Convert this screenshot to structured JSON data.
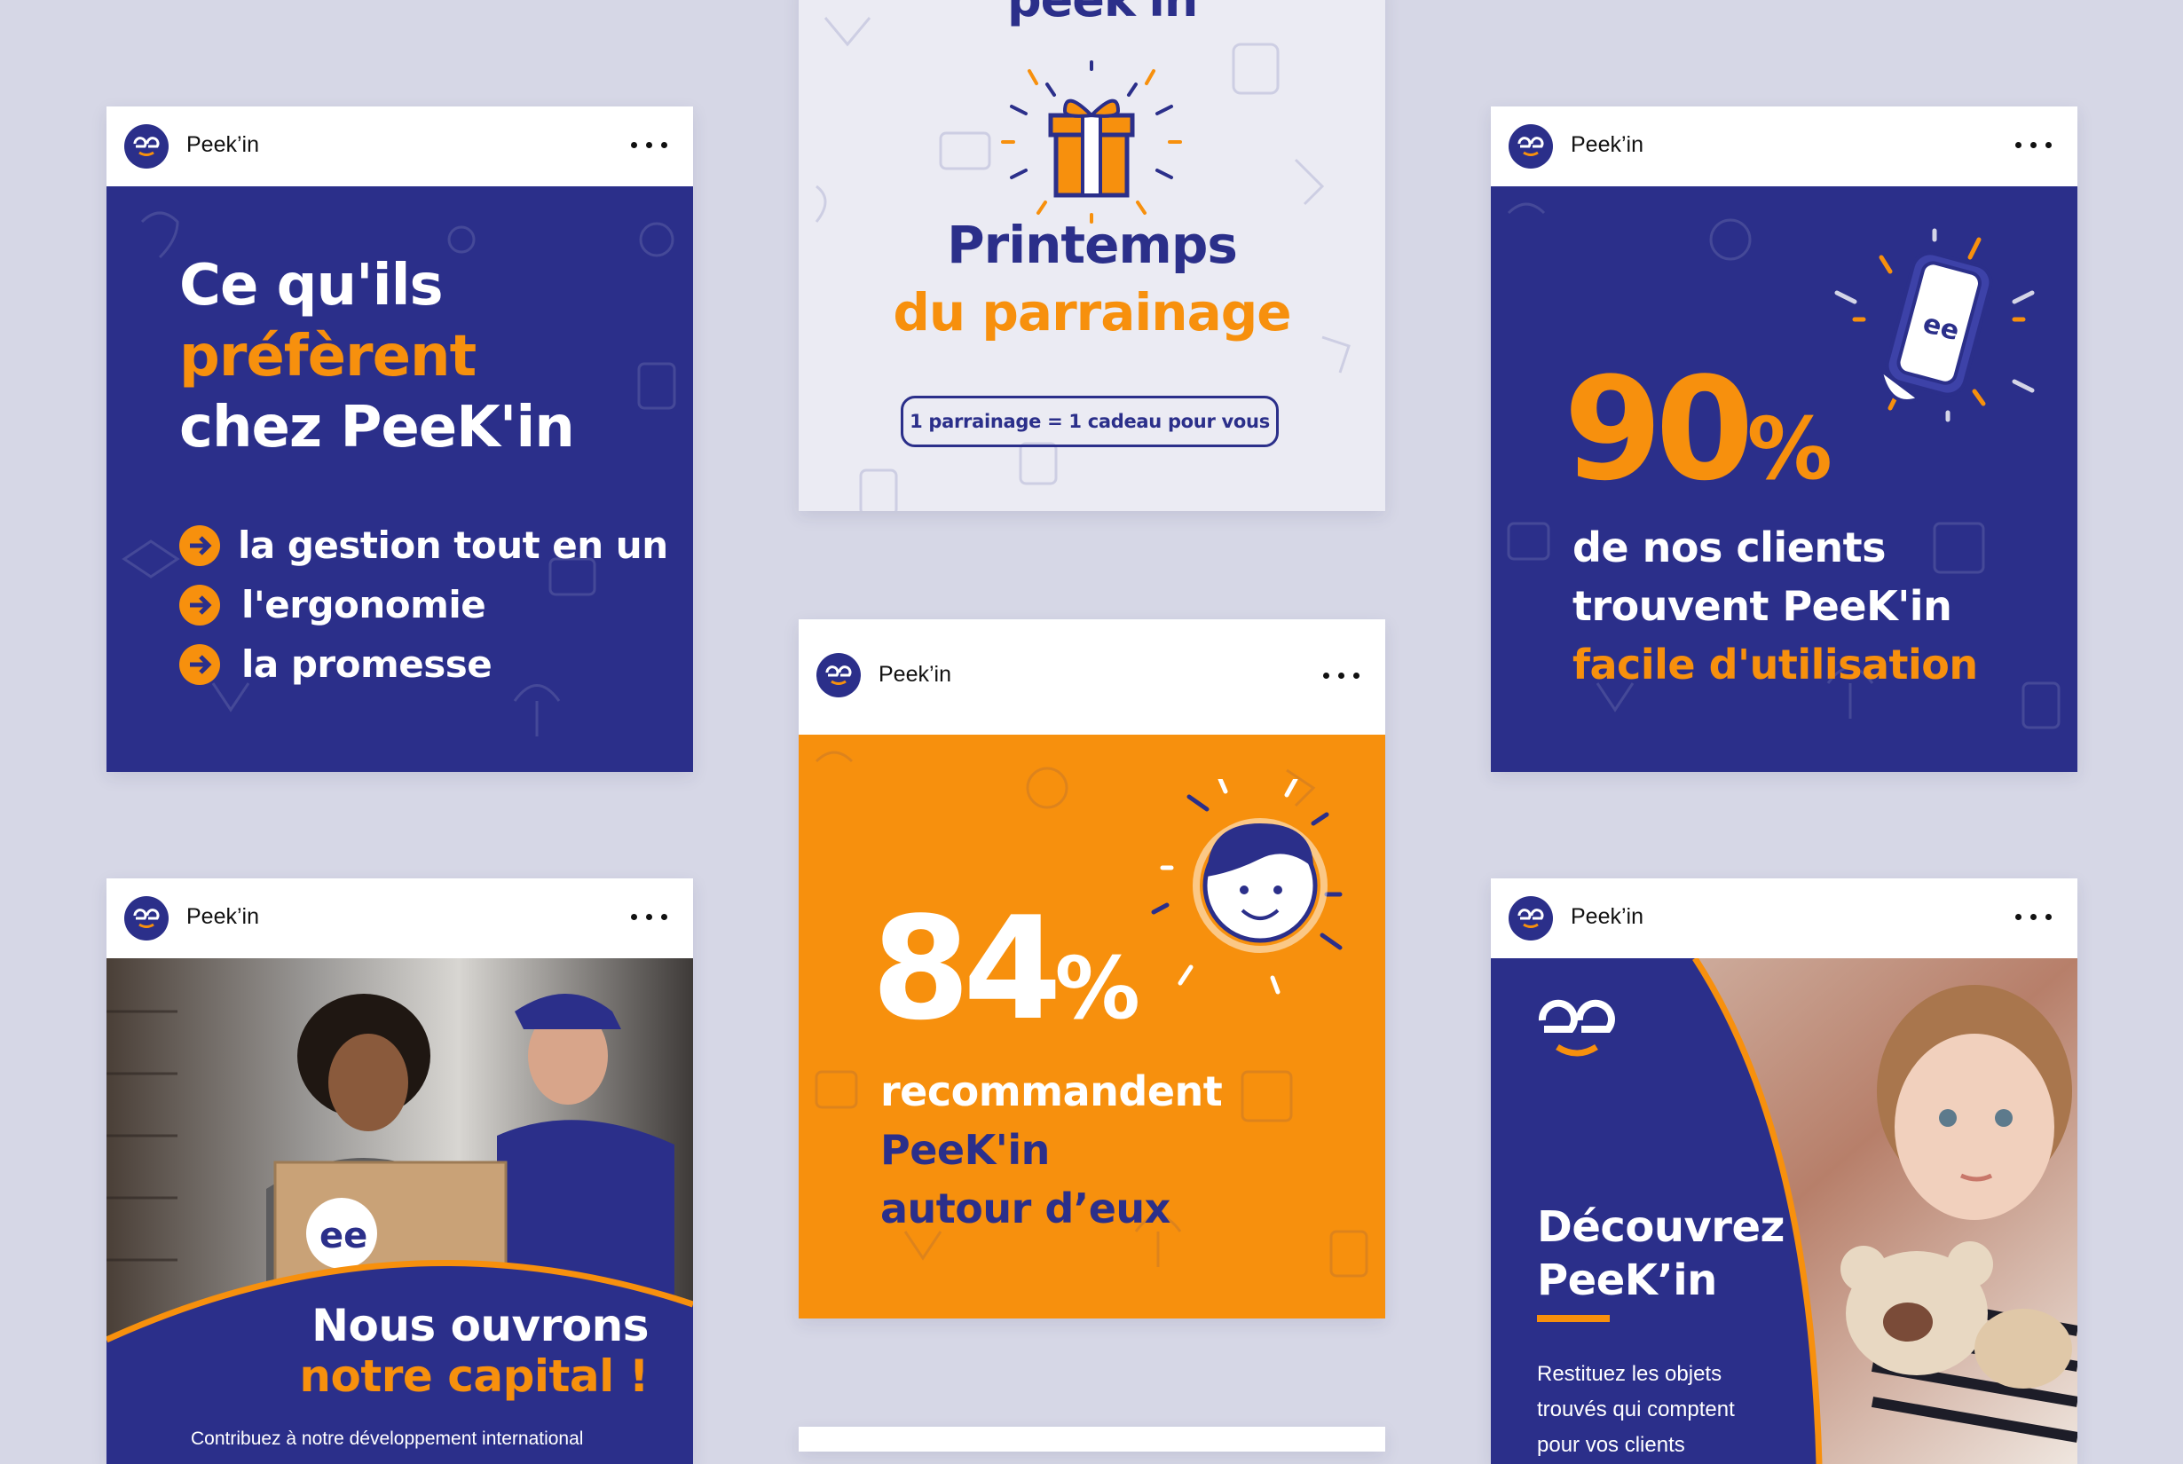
{
  "brand": {
    "name": "Peek’in",
    "navy": "#2b2f8a",
    "orange": "#f7900d",
    "background": "#d6d7e6"
  },
  "card1": {
    "title_line1": "Ce qu'ils",
    "title_line2": "préfèrent",
    "title_line3": "chez PeeK'in",
    "items": [
      "la gestion tout en un",
      "l'ergonomie",
      "la promesse"
    ]
  },
  "card2": {
    "logo_text": "peek'in",
    "title": "Printemps",
    "subtitle": "du parrainage",
    "badge": "1 parrainage = 1 cadeau pour vous"
  },
  "card3": {
    "stat": "90",
    "percent": "%",
    "line1": "de nos clients",
    "line2": "trouvent PeeK'in",
    "line3": "facile d'utilisation"
  },
  "card4": {
    "stat": "84",
    "percent": "%",
    "line1": "recommandent",
    "line2": "PeeK'in",
    "line3": "autour d’eux"
  },
  "card5": {
    "title_line1": "Nous ouvrons",
    "title_line2": "notre capital !",
    "body": "Contribuez à notre développement international"
  },
  "card6": {
    "title_line1": "Découvrez",
    "title_line2": "PeeK’in",
    "body_line1": "Restituez les objets",
    "body_line2": "trouvés qui comptent",
    "body_line3": "pour vos clients"
  },
  "icons": [
    "ellipsis-icon",
    "arrow-right-icon",
    "gift-icon",
    "phone-icon",
    "face-icon",
    "peekin-logo-icon"
  ]
}
